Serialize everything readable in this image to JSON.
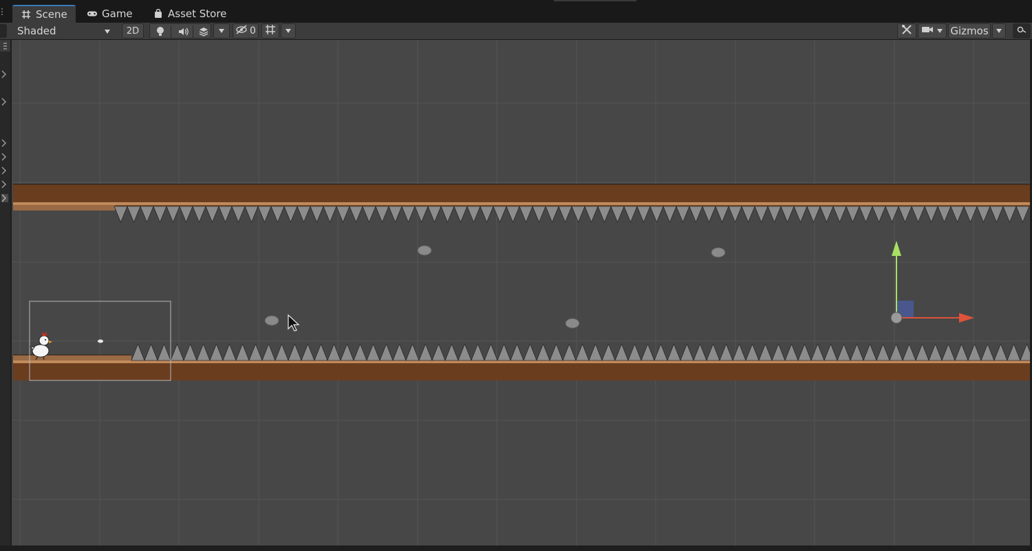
{
  "tabs": [
    {
      "label": "Scene",
      "icon": "grid-hash-icon",
      "active": true
    },
    {
      "label": "Game",
      "icon": "gamepad-icon",
      "active": false
    },
    {
      "label": "Asset Store",
      "icon": "shopping-bag-icon",
      "active": false
    }
  ],
  "toolbar": {
    "shading_mode": "Shaded",
    "toggle_2d": "2D",
    "hidden_count": "0",
    "gizmos_label": "Gizmos"
  },
  "scene": {
    "objects": [
      "chicken-player",
      "ceiling-platform",
      "floor-platform",
      "ceiling-spikes",
      "floor-spikes",
      "rocks"
    ],
    "colors": {
      "background": "#474747",
      "platform_dark": "#6b3d1f",
      "platform_light": "#9a6a44",
      "spike": "#8c8c8c",
      "gizmo_x": "#e0533a",
      "gizmo_y": "#a8e063",
      "gizmo_z": "#4a5a9a"
    }
  }
}
